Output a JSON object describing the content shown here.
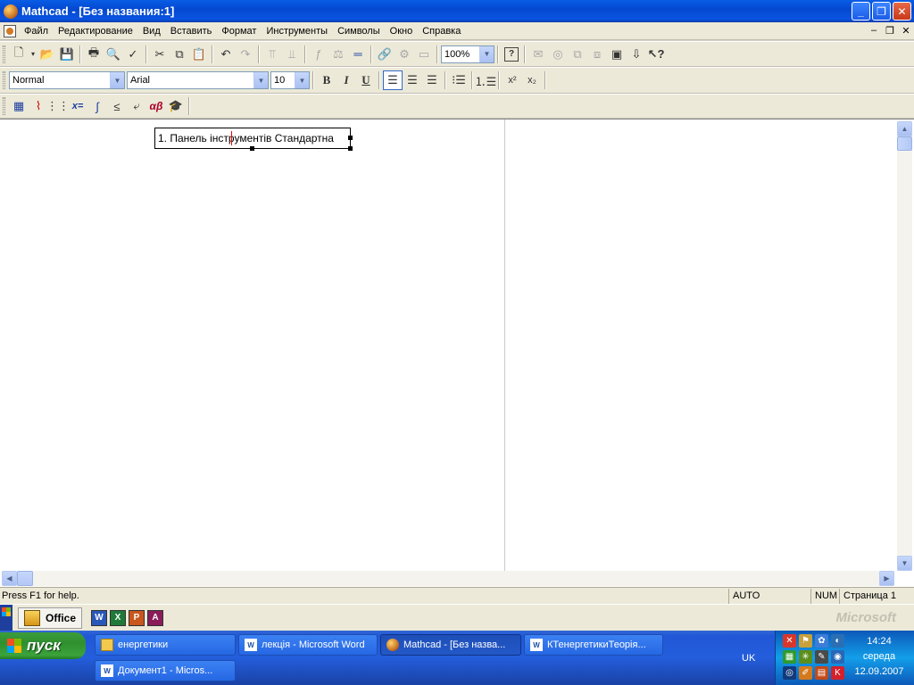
{
  "window": {
    "title": "Mathcad - [Без названия:1]"
  },
  "menu": [
    "Файл",
    "Редактирование",
    "Вид",
    "Вставить",
    "Формат",
    "Инструменты",
    "Символы",
    "Окно",
    "Справка"
  ],
  "toolbar": {
    "zoom": "100%"
  },
  "format_bar": {
    "style": "Normal",
    "font": "Arial",
    "size": "10"
  },
  "math_bar": {
    "eval_label": "x=",
    "greek_label": "αβ"
  },
  "document": {
    "text_region_prefix": "1. Панель інс",
    "text_region_suffix": "трументів Стандартна"
  },
  "status": {
    "help": "Press F1 for help.",
    "mode": "AUTO",
    "num": "NUM",
    "page": "Страница 1"
  },
  "office_bar": {
    "label": "Office",
    "brand": "Microsoft"
  },
  "taskbar": {
    "start": "пуск",
    "buttons": [
      {
        "label": "енергетики",
        "icon": "folder-icon"
      },
      {
        "label": "лекція - Microsoft Word",
        "icon": "word-icon"
      },
      {
        "label": "Mathcad - [Без назва...",
        "icon": "mathcad-icon"
      },
      {
        "label": "КТенергетикиТеорія...",
        "icon": "word-icon"
      },
      {
        "label": "Документ1 - Micros...",
        "icon": "word-icon"
      }
    ],
    "language": "UK",
    "clock": {
      "time": "14:24",
      "day": "середа",
      "date": "12.09.2007"
    }
  }
}
